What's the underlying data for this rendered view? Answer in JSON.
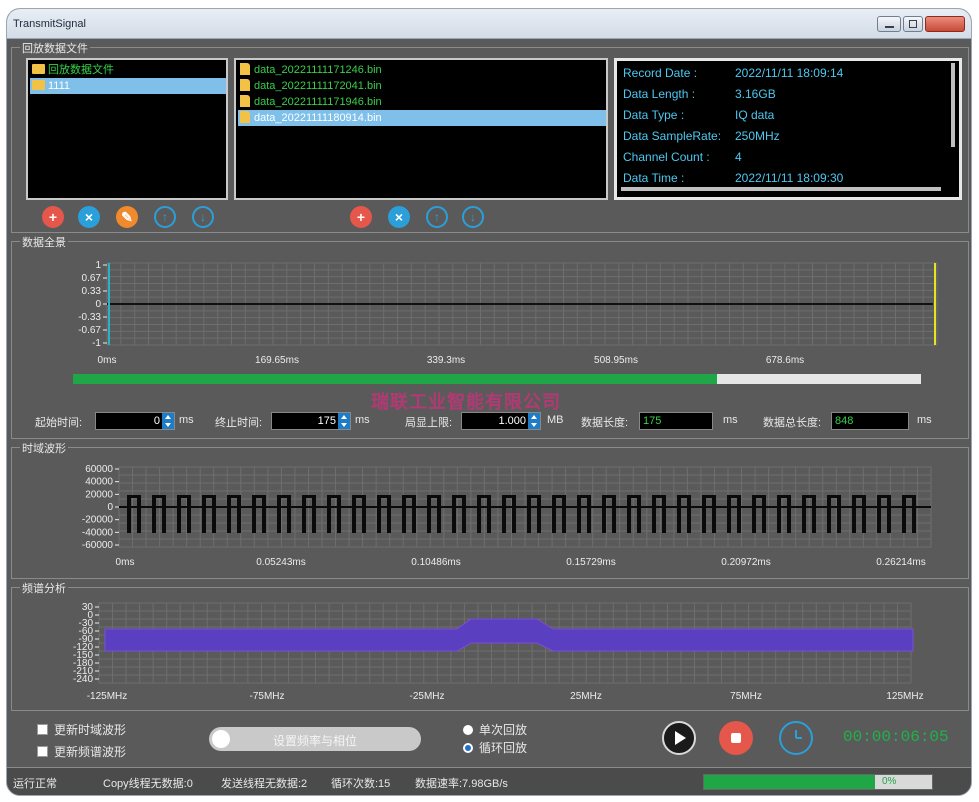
{
  "window": {
    "title": "TransmitSignal"
  },
  "groups": {
    "playback_files": "回放数据文件",
    "overview": "数据全景",
    "time_wave": "时域波形",
    "spectrum": "频谱分析"
  },
  "folder_tree": [
    {
      "label": "回放数据文件",
      "selected": false
    },
    {
      "label": "1111",
      "selected": true
    }
  ],
  "files": [
    {
      "name": "data_20221111171246.bin",
      "selected": false
    },
    {
      "name": "data_20221111172041.bin",
      "selected": false
    },
    {
      "name": "data_20221111171946.bin",
      "selected": false
    },
    {
      "name": "data_20221111180914.bin",
      "selected": true
    }
  ],
  "info": [
    {
      "key": "Record Date   :",
      "value": "2022/11/11 18:09:14"
    },
    {
      "key": "Data Length   :",
      "value": "3.16GB"
    },
    {
      "key": "Data Type     :",
      "value": "IQ data"
    },
    {
      "key": "Data SampleRate:",
      "value": "250MHz"
    },
    {
      "key": "Channel Count :",
      "value": "4"
    },
    {
      "key": "Data Time     :",
      "value": "2022/11/11 18:09:30"
    }
  ],
  "folder_buttons": [
    "add-icon",
    "delete-icon",
    "edit-icon",
    "move-up-icon",
    "move-down-icon"
  ],
  "file_buttons": [
    "add-icon",
    "delete-icon",
    "move-up-icon",
    "move-down-icon"
  ],
  "overview_axis": {
    "y_ticks": [
      "1",
      "0.67",
      "0.33",
      "0",
      "-0.33",
      "-0.67",
      "-1"
    ],
    "x_ticks": [
      "0ms",
      "169.65ms",
      "339.3ms",
      "508.95ms",
      "678.6ms"
    ],
    "progress": 0.76
  },
  "controls": {
    "start_label": "起始时间:",
    "start_value": "0",
    "start_unit": "ms",
    "end_label": "终止时间:",
    "end_value": "175",
    "end_unit": "ms",
    "limit_label": "局显上限:",
    "limit_value": "1.000",
    "limit_unit": "MB",
    "len_label": "数据长度:",
    "len_value": "175",
    "len_unit": "ms",
    "total_label": "数据总长度:",
    "total_value": "848",
    "total_unit": "ms"
  },
  "watermark": "瑞联工业智能有限公司",
  "time_axis": {
    "y_ticks": [
      "60000",
      "40000",
      "20000",
      "0",
      "-20000",
      "-40000",
      "-60000"
    ],
    "x_ticks": [
      "0ms",
      "0.05243ms",
      "0.10486ms",
      "0.15729ms",
      "0.20972ms",
      "0.26214ms"
    ]
  },
  "spectrum_axis": {
    "y_ticks": [
      "30",
      "0",
      "-30",
      "-60",
      "-90",
      "-120",
      "-150",
      "-180",
      "-210",
      "-240"
    ],
    "x_ticks": [
      "-125MHz",
      "-75MHz",
      "-25MHz",
      "25MHz",
      "75MHz",
      "125MHz"
    ]
  },
  "bottom": {
    "update_time": "更新时域波形",
    "update_spectrum": "更新频谱波形",
    "set_freq": "设置频率与相位",
    "single_play": "单次回放",
    "loop_play": "循环回放",
    "elapsed": "00:00:06:05"
  },
  "status": {
    "state": "运行正常",
    "copy": "Copy线程无数据:0",
    "send": "发送线程无数据:2",
    "loops": "循环次数:15",
    "rate": "数据速率:7.98GB/s",
    "progress": 0.75,
    "progress_text": "0%"
  },
  "colors": {
    "plot_bg": "#000000",
    "trace_green": "#1fb34a",
    "wave_black": "#0a0a0a",
    "spectrum_purple": "#5a3fc0",
    "marker_yellow": "#e6e61a"
  }
}
